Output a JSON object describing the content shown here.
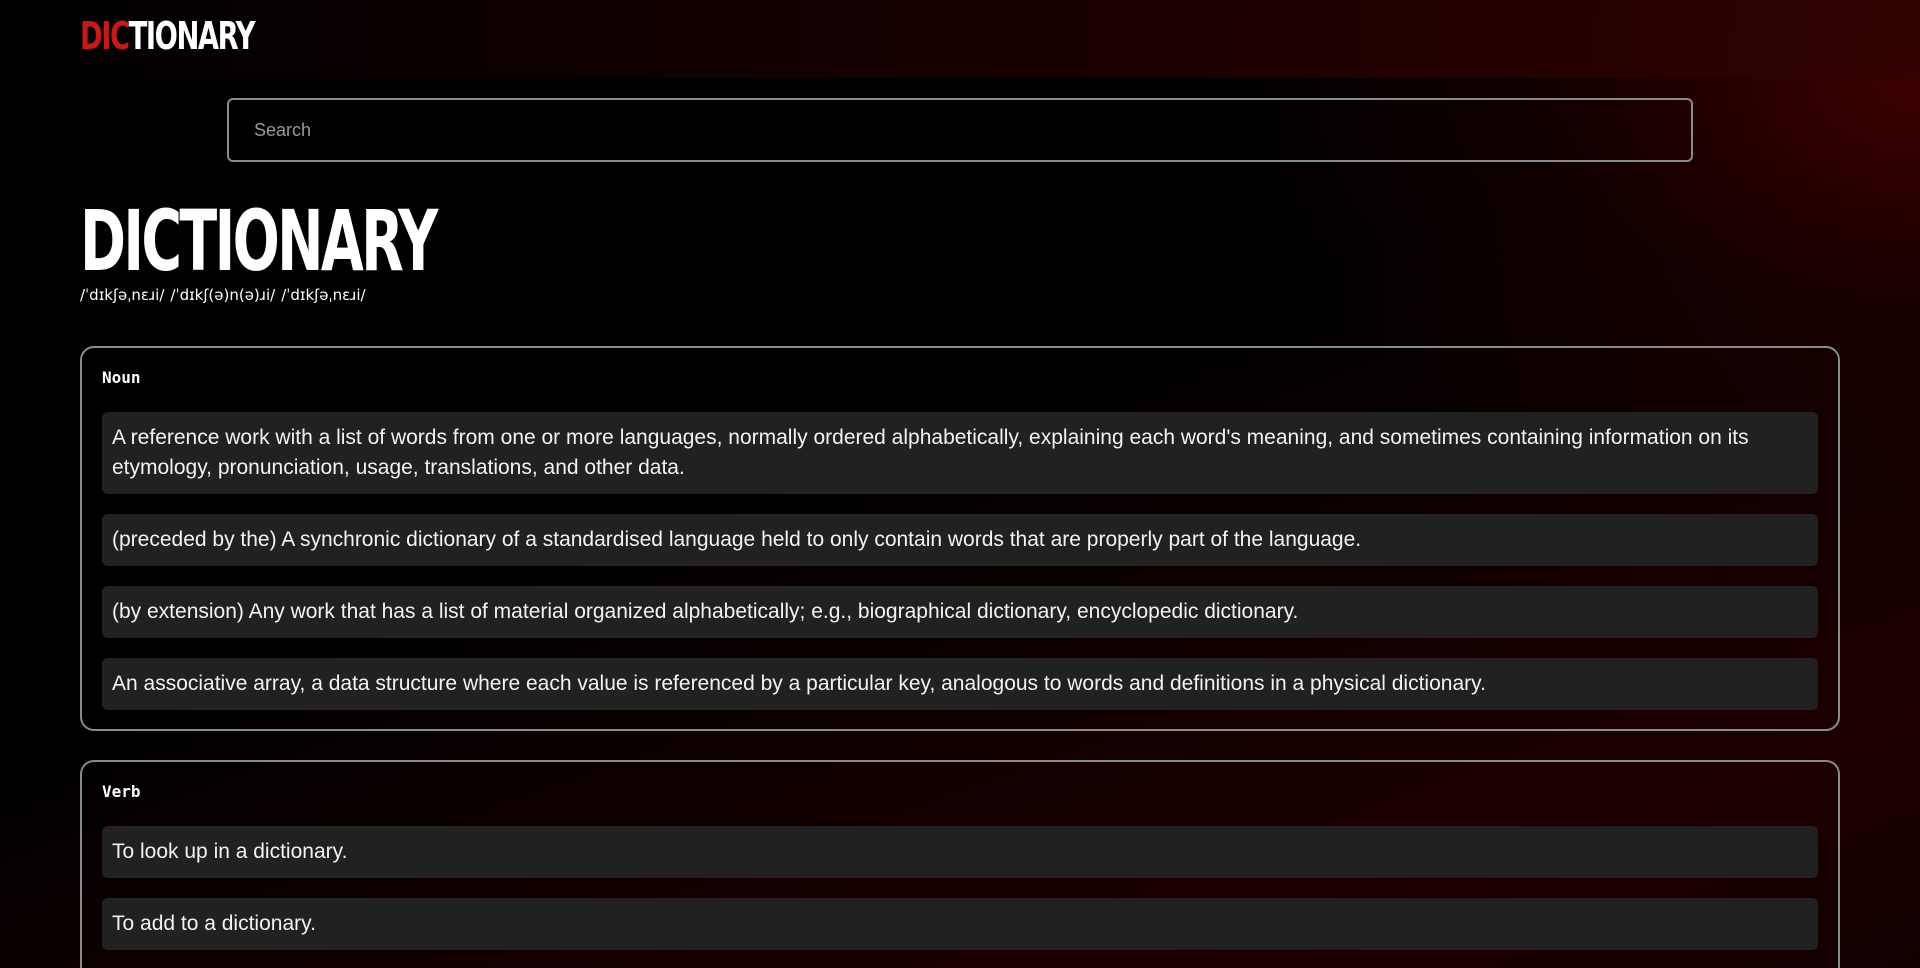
{
  "header": {
    "logo_accent": "DIC",
    "logo_rest": "TIONARY",
    "accent_color": "#c41a1a"
  },
  "search": {
    "placeholder": "Search",
    "value": ""
  },
  "entry": {
    "word": "DICTIONARY",
    "phonetics": [
      "/ˈdɪkʃəˌnɛɹi/",
      "/ˈdɪkʃ(ə)n(ə)ɹi/",
      "/ˈdɪkʃəˌnɛɹi/"
    ],
    "meanings": [
      {
        "part_of_speech": "Noun",
        "definitions": [
          "A reference work with a list of words from one or more languages, normally ordered alphabetically, explaining each word's meaning, and sometimes containing information on its etymology, pronunciation, usage, translations, and other data.",
          "(preceded by the) A synchronic dictionary of a standardised language held to only contain words that are properly part of the language.",
          "(by extension) Any work that has a list of material organized alphabetically; e.g., biographical dictionary, encyclopedic dictionary.",
          "An associative array, a data structure where each value is referenced by a particular key, analogous to words and definitions in a physical dictionary."
        ]
      },
      {
        "part_of_speech": "Verb",
        "definitions": [
          "To look up in a dictionary.",
          "To add to a dictionary."
        ]
      }
    ]
  },
  "theme": {
    "background": "#000000",
    "card_border": "#8a8a8a",
    "definition_bg": "#212121"
  }
}
